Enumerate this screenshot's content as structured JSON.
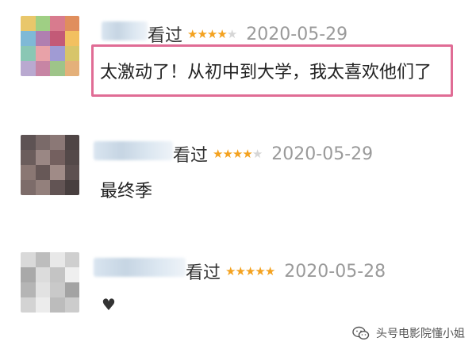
{
  "reviews": [
    {
      "seen_label": "看过",
      "rating": 4,
      "max_rating": 5,
      "date": "2020-05-29",
      "comment": "太激动了！从初中到大学，我太喜欢他们了",
      "highlighted": true,
      "avatar_colors": [
        "#e9c76b",
        "#9fcf84",
        "#d87b8e",
        "#e08e5d",
        "#7fb9d6",
        "#b07fb0",
        "#c35a77",
        "#f2c060",
        "#8ac7b4",
        "#e8a2a8",
        "#a09bd4",
        "#d7c56a",
        "#b9a9d0",
        "#c785a4",
        "#9ec489",
        "#e4b07a"
      ]
    },
    {
      "seen_label": "看过",
      "rating": 4,
      "max_rating": 5,
      "date": "2020-05-29",
      "comment": "最终季",
      "highlighted": false,
      "avatar_colors": [
        "#5e5354",
        "#7a6a69",
        "#8b7876",
        "#4f4545",
        "#6b5d5c",
        "#9a8784",
        "#74605f",
        "#544949",
        "#8a7773",
        "#675857",
        "#a08b87",
        "#5d5050",
        "#7d6c6a",
        "#93807c",
        "#625454",
        "#483f3f"
      ]
    },
    {
      "seen_label": "看过",
      "rating": 5,
      "max_rating": 5,
      "date": "2020-05-28",
      "comment": "",
      "reaction": "♥",
      "highlighted": false,
      "avatar_colors": [
        "#d9d9d9",
        "#bdbdbd",
        "#e8e8e8",
        "#cfcfcf",
        "#a9a9a9",
        "#dcdcdc",
        "#c4c4c4",
        "#efefef",
        "#b5b5b5",
        "#e2e2e2",
        "#c9c9c9",
        "#a3a3a3",
        "#d3d3d3",
        "#ececec",
        "#bcbcbc",
        "#cccccc"
      ]
    }
  ],
  "watermark": {
    "text": "头号电影院懂小姐",
    "icon": "wechat-icon"
  },
  "colors": {
    "star_on": "#f4a21f",
    "star_off": "#d6d6d6",
    "highlight_border": "#e06c95",
    "date_text": "#9a9a9a"
  }
}
